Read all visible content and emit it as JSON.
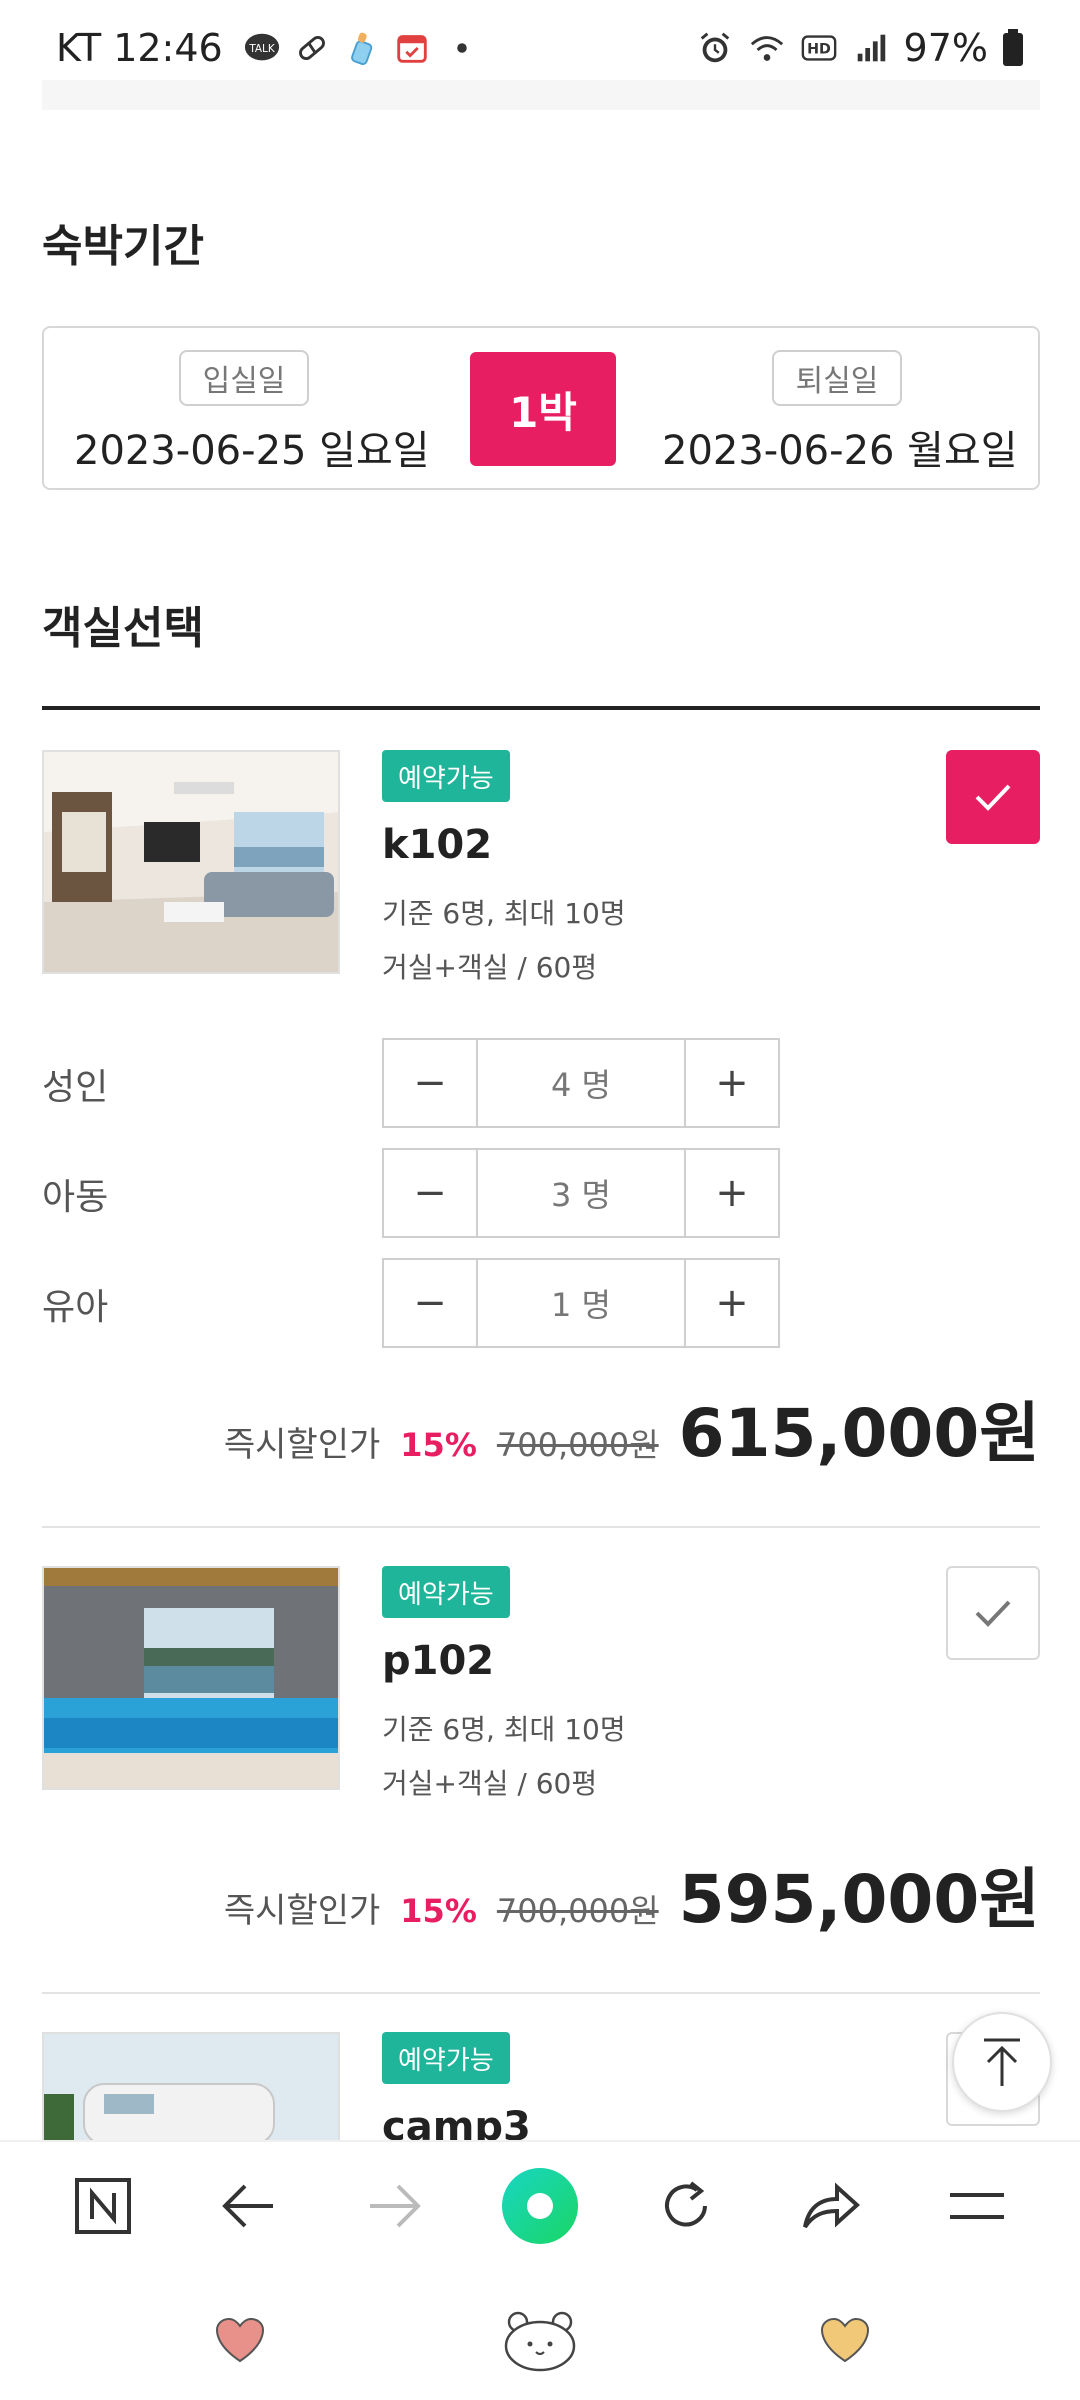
{
  "status_bar": {
    "carrier": "KT",
    "time": "12:46",
    "battery": "97%",
    "left_icons": [
      "talk-icon",
      "pill-icon",
      "baby-bottle-icon",
      "calendar-icon",
      "dot-icon"
    ],
    "right_icons": [
      "alarm-icon",
      "wifi-icon",
      "hd-icon",
      "signal-icon",
      "battery-icon"
    ]
  },
  "stay": {
    "title": "숙박기간",
    "checkin_label": "입실일",
    "checkin_value": "2023-06-25 일요일",
    "nights": "1박",
    "checkout_label": "퇴실일",
    "checkout_value": "2023-06-26 월요일"
  },
  "room_select": {
    "title": "객실선택"
  },
  "rooms": [
    {
      "status": "예약가능",
      "name": "k102",
      "capacity": "기준 6명, 최대 10명",
      "type": "거실+객실 / 60평",
      "selected": true,
      "price_label": "즉시할인가",
      "discount": "15%",
      "original_price": "700,000원",
      "final_price": "615,000원"
    },
    {
      "status": "예약가능",
      "name": "p102",
      "capacity": "기준 6명, 최대 10명",
      "type": "거실+객실 / 60평",
      "selected": false,
      "price_label": "즉시할인가",
      "discount": "15%",
      "original_price": "700,000원",
      "final_price": "595,000원"
    },
    {
      "status": "예약가능",
      "name": "camp3"
    }
  ],
  "guests": [
    {
      "label": "성인",
      "value": "4 명",
      "minus": "−",
      "plus": "+"
    },
    {
      "label": "아동",
      "value": "3 명",
      "minus": "−",
      "plus": "+"
    },
    {
      "label": "유아",
      "value": "1 명",
      "minus": "−",
      "plus": "+"
    }
  ],
  "bottom_nav": {
    "items": [
      "naver-home-icon",
      "back-icon",
      "forward-icon",
      "green-dot-icon",
      "refresh-icon",
      "share-icon",
      "menu-icon"
    ]
  },
  "colors": {
    "accent": "#e81e63",
    "tag_green": "#1fb59a",
    "green_dot": "#19d68a"
  }
}
